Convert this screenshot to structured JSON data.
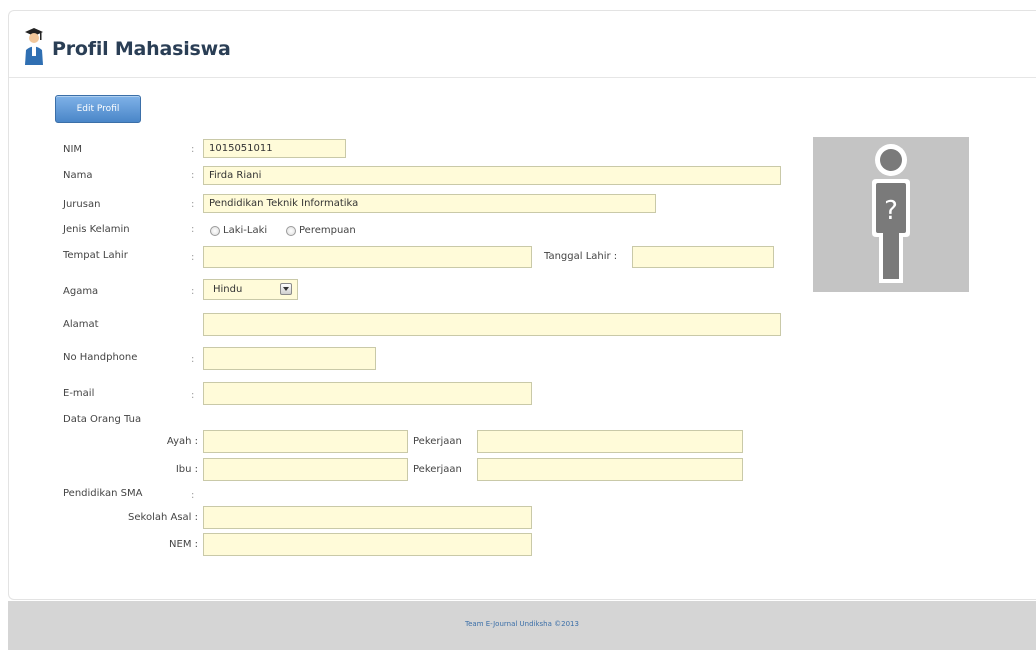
{
  "header": {
    "title": "Profil Mahasiswa",
    "icon": "student-graduate-icon"
  },
  "toolbar": {
    "edit_label": "Edit Profil"
  },
  "labels": {
    "nim": "NIM",
    "nama": "Nama",
    "jurusan": "Jurusan",
    "jenis_kelamin": "Jenis Kelamin",
    "tempat_lahir": "Tempat Lahir",
    "tanggal_lahir": "Tanggal Lahir :",
    "agama": "Agama",
    "alamat": "Alamat",
    "no_handphone": "No Handphone",
    "email": "E-mail",
    "data_orang_tua": "Data Orang Tua",
    "ayah": "Ayah :",
    "ibu": "Ibu :",
    "pekerjaan": "Pekerjaan",
    "pendidikan_sma": "Pendidikan SMA",
    "sekolah_asal": "Sekolah Asal :",
    "nem": "NEM :"
  },
  "separator": ":",
  "values": {
    "nim": "1015051011",
    "nama": "Firda Riani",
    "jurusan": "Pendidikan Teknik Informatika",
    "tempat_lahir": "",
    "tanggal_lahir": "",
    "agama": "Hindu",
    "alamat": "",
    "no_handphone": "",
    "email": "",
    "ayah": "",
    "ayah_pekerjaan": "",
    "ibu": "",
    "ibu_pekerjaan": "",
    "sekolah_asal": "",
    "nem": ""
  },
  "gender_options": [
    "Laki-Laki",
    "Perempuan"
  ],
  "photo": {
    "placeholder_glyph": "?",
    "icon": "unknown-person-icon"
  },
  "footer": {
    "text": "Team E-Journal Undiksha ©2013"
  },
  "colors": {
    "title": "#2a3e55",
    "button": "#4a86c8",
    "field_bg": "#fffbd9",
    "footer_bg": "#d5d5d5",
    "footer_text": "#3b6fa8"
  }
}
